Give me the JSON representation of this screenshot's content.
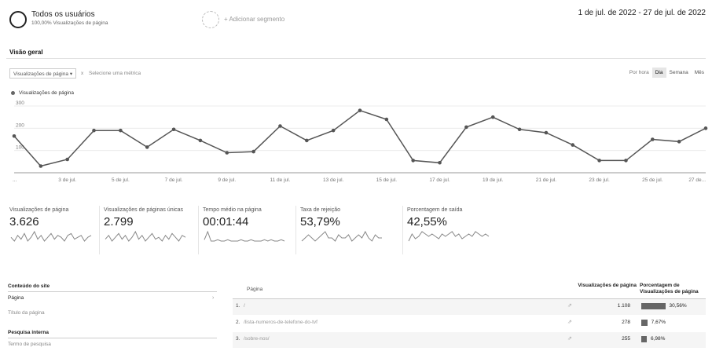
{
  "segment": {
    "name": "Todos os usuários",
    "subtitle": "100,00% Visualizações de página",
    "add_label": "+ Adicionar segmento"
  },
  "date_range": "1 de jul. de 2022 - 27 de jul. de 2022",
  "overview": {
    "title": "Visão geral",
    "metric_select": "Visualizações de página",
    "vs": "x",
    "select_metric": "Selecione uma métrica",
    "period_label": "Por hora",
    "period_buttons": [
      "Dia",
      "Semana",
      "Mês"
    ],
    "period_active": "Dia"
  },
  "legend_label": "Visualizações de página",
  "chart_data": {
    "type": "line",
    "series": [
      {
        "name": "Visualizações de página",
        "values": [
          165,
          30,
          60,
          190,
          190,
          115,
          195,
          145,
          90,
          95,
          210,
          145,
          190,
          280,
          240,
          55,
          45,
          205,
          250,
          195,
          180,
          125,
          55,
          55,
          150,
          140,
          200
        ]
      }
    ],
    "x": [
      "1 de jul.",
      "2 de jul.",
      "3 de jul.",
      "4 de jul.",
      "5 de jul.",
      "6 de jul.",
      "7 de jul.",
      "8 de jul.",
      "9 de jul.",
      "10 de jul.",
      "11 de jul.",
      "12 de jul.",
      "13 de jul.",
      "14 de jul.",
      "15 de jul.",
      "16 de jul.",
      "17 de jul.",
      "18 de jul.",
      "19 de jul.",
      "20 de jul.",
      "21 de jul.",
      "22 de jul.",
      "23 de jul.",
      "24 de jul.",
      "25 de jul.",
      "26 de jul.",
      "27 de jul."
    ],
    "x_tick_labels": [
      "...",
      "3 de jul.",
      "5 de jul.",
      "7 de jul.",
      "9 de jul.",
      "11 de jul.",
      "13 de jul.",
      "15 de jul.",
      "17 de jul.",
      "19 de jul.",
      "21 de jul.",
      "23 de jul.",
      "25 de jul.",
      "27 de..."
    ],
    "y_ticks": [
      "300",
      "200",
      "100"
    ],
    "ylim": [
      0,
      300
    ],
    "grid": true
  },
  "metrics": [
    {
      "label": "Visualizações de página",
      "value": "3.626",
      "spark": [
        5,
        3,
        6,
        4,
        7,
        3,
        5,
        8,
        4,
        6,
        3,
        5,
        7,
        4,
        6,
        5,
        3,
        6,
        7,
        4,
        5,
        6,
        3,
        5,
        6
      ]
    },
    {
      "label": "Visualizações de páginas únicas",
      "value": "2.799",
      "spark": [
        4,
        6,
        3,
        5,
        7,
        4,
        6,
        3,
        5,
        8,
        4,
        6,
        3,
        5,
        7,
        4,
        5,
        3,
        6,
        4,
        7,
        5,
        3,
        6,
        5
      ]
    },
    {
      "label": "Tempo médio na página",
      "value": "00:01:44",
      "spark": [
        3,
        9,
        2,
        2,
        3,
        2,
        2,
        3,
        2,
        2,
        2,
        3,
        2,
        2,
        3,
        2,
        2,
        2,
        3,
        2,
        3,
        2,
        2,
        3,
        2
      ]
    },
    {
      "label": "Taxa de rejeição",
      "value": "53,79%",
      "spark": [
        4,
        5,
        6,
        5,
        4,
        5,
        6,
        7,
        5,
        5,
        4,
        6,
        5,
        5,
        6,
        4,
        5,
        6,
        5,
        7,
        5,
        4,
        6,
        5,
        5
      ]
    },
    {
      "label": "Porcentagem de saída",
      "value": "42,55%",
      "spark": [
        3,
        6,
        4,
        5,
        7,
        6,
        5,
        6,
        5,
        4,
        6,
        5,
        6,
        7,
        5,
        6,
        4,
        5,
        6,
        5,
        7,
        6,
        5,
        6,
        5
      ]
    }
  ],
  "left_panel": {
    "heading": "Conteúdo do site",
    "items": [
      {
        "label": "Página",
        "selected": true
      },
      {
        "label": "Título da página",
        "selected": false
      }
    ],
    "search_heading": "Pesquisa interna",
    "search_items": [
      "Termo de pesquisa"
    ]
  },
  "table": {
    "col_page": "Página",
    "col_views": "Visualizações de página",
    "col_pct": "Porcentagem de Visualizações de página",
    "rows": [
      {
        "index": "1.",
        "page": "/",
        "views": "1.108",
        "pct": "30,56%",
        "share": 0.3056
      },
      {
        "index": "2.",
        "page": "/lista-numeros-de-telefone-do-tvf",
        "views": "278",
        "pct": "7,67%",
        "share": 0.0767
      },
      {
        "index": "3.",
        "page": "/sobre-nos/",
        "views": "255",
        "pct": "6,98%",
        "share": 0.0698
      }
    ]
  }
}
